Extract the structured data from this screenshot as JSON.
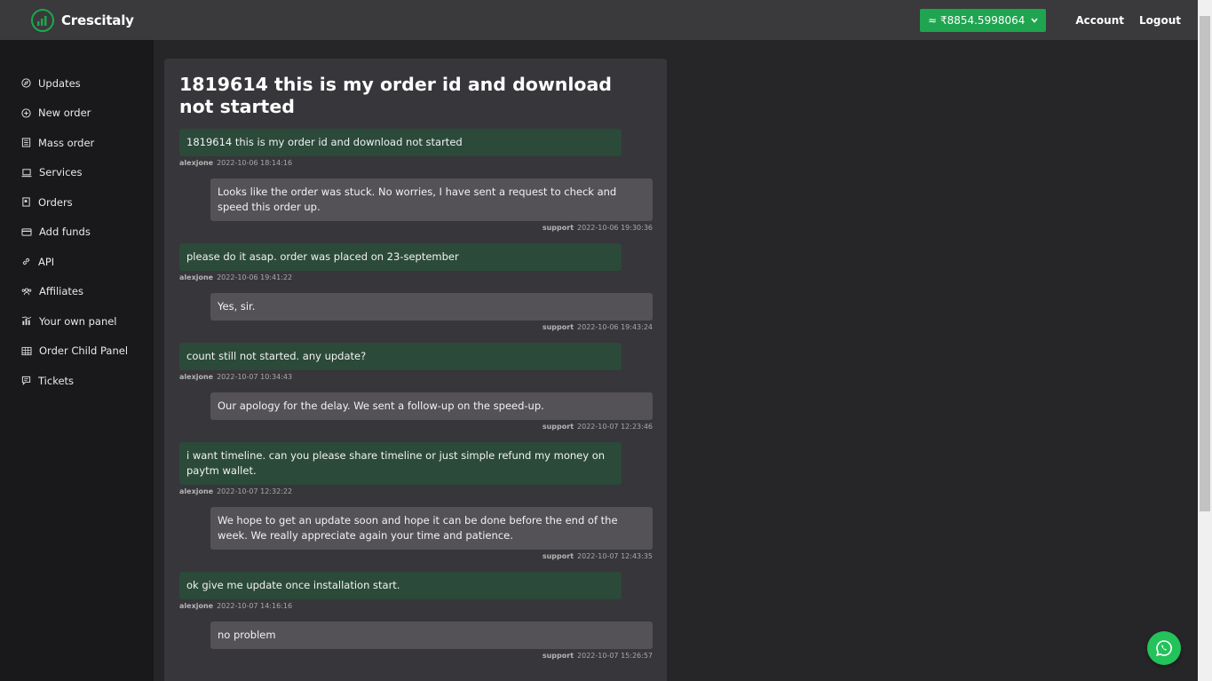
{
  "header": {
    "brand": "Crescitaly",
    "balance": "≈ ₹8854.5998064",
    "account_label": "Account",
    "logout_label": "Logout"
  },
  "sidebar": {
    "items": [
      {
        "label": "Updates",
        "icon": "compass-icon"
      },
      {
        "label": "New order",
        "icon": "plus-circle-icon"
      },
      {
        "label": "Mass order",
        "icon": "list-icon"
      },
      {
        "label": "Services",
        "icon": "laptop-icon"
      },
      {
        "label": "Orders",
        "icon": "document-icon"
      },
      {
        "label": "Add funds",
        "icon": "credit-card-icon"
      },
      {
        "label": "API",
        "icon": "link-icon"
      },
      {
        "label": "Affiliates",
        "icon": "users-icon"
      },
      {
        "label": "Your own panel",
        "icon": "chart-icon"
      },
      {
        "label": "Order Child Panel",
        "icon": "grid-icon"
      },
      {
        "label": "Tickets",
        "icon": "chat-icon"
      }
    ]
  },
  "ticket": {
    "title": "1819614 this is my order id and download not started",
    "messages": [
      {
        "role": "user",
        "text": "1819614 this is my order id and download not started",
        "author": "alexjone",
        "time": "2022-10-06 18:14:16"
      },
      {
        "role": "support",
        "text": "Looks like the order was stuck. No worries, I have sent a request to check and speed this order up.",
        "author": "support",
        "time": "2022-10-06 19:30:36"
      },
      {
        "role": "user",
        "text": "please do it asap. order was placed on 23-september",
        "author": "alexjone",
        "time": "2022-10-06 19:41:22"
      },
      {
        "role": "support",
        "text": "Yes, sir.",
        "author": "support",
        "time": "2022-10-06 19:43:24"
      },
      {
        "role": "user",
        "text": "count still not started. any update?",
        "author": "alexjone",
        "time": "2022-10-07 10:34:43"
      },
      {
        "role": "support",
        "text": "Our apology for the delay. We sent a follow-up on the speed-up.",
        "author": "support",
        "time": "2022-10-07 12:23:46"
      },
      {
        "role": "user",
        "text": "i want timeline. can you please share timeline or just simple refund my money on paytm wallet.",
        "author": "alexjone",
        "time": "2022-10-07 12:32:22"
      },
      {
        "role": "support",
        "text": "We hope to get an update soon and hope it can be done before the end of the week. We really appreciate again your time and patience.",
        "author": "support",
        "time": "2022-10-07 12:43:35"
      },
      {
        "role": "user",
        "text": "ok give me update once installation start.",
        "author": "alexjone",
        "time": "2022-10-07 14:16:16"
      },
      {
        "role": "support",
        "text": "no problem",
        "author": "support",
        "time": "2022-10-07 15:26:57"
      }
    ]
  },
  "colors": {
    "accent": "#1fa44f",
    "user_bubble": "#2b4a3a",
    "support_bubble": "#545257"
  }
}
